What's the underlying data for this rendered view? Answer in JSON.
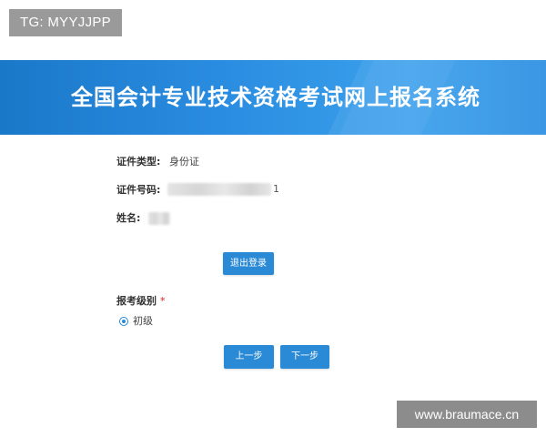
{
  "overlay": {
    "tg_label": "TG: MYYJJPP",
    "watermark": "www.braumace.cn"
  },
  "header": {
    "title": "全国会计专业技术资格考试网上报名系统",
    "color_start": "#1a78c9",
    "color_end": "#3aa0ec"
  },
  "identity": {
    "id_type_label": "证件类型:",
    "id_type_value": "身份证",
    "id_number_label": "证件号码:",
    "id_number_tail": "1",
    "name_label": "姓名:"
  },
  "actions": {
    "logout_label": "退出登录",
    "prev_label": "上一步",
    "next_label": "下一步",
    "button_color": "#2a8ad6"
  },
  "exam_level": {
    "label": "报考级别",
    "required_mark": "*",
    "options": [
      {
        "label": "初级",
        "selected": true
      }
    ]
  }
}
